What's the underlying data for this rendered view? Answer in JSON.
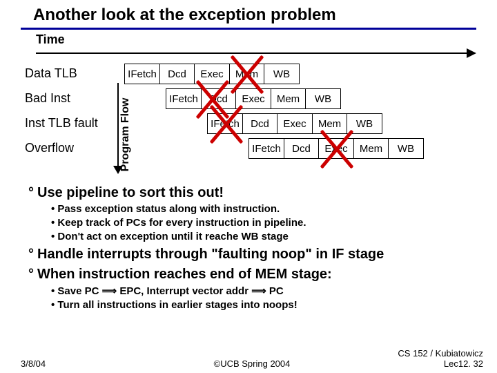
{
  "title": "Another look at the exception problem",
  "time_label": "Time",
  "program_flow_label": "Program Flow",
  "rows": {
    "r0": "Data TLB",
    "r1": "Bad Inst",
    "r2": "Inst TLB fault",
    "r3": "Overflow"
  },
  "stages": {
    "ifetch": "IFetch",
    "dcd": "Dcd",
    "exec": "Exec",
    "mem": "Mem",
    "wb": "WB"
  },
  "points": {
    "p1": "Use pipeline to sort this out!",
    "p1a": "Pass exception status along with instruction.",
    "p1b": "Keep track of PCs for every instruction in pipeline.",
    "p1c": "Don't act on exception until it reache WB stage",
    "p2": "Handle interrupts through \"faulting noop\" in IF stage",
    "p3": "When instruction reaches end of MEM stage:",
    "p3a_pre": "Save PC ",
    "p3a_mid": " EPC, Interrupt vector addr ",
    "p3a_post": " PC",
    "p3b": "Turn all instructions in earlier stages into noops!"
  },
  "footer": {
    "date": "3/8/04",
    "copyright": "©UCB Spring 2004",
    "course": "CS 152 / Kubiatowicz",
    "lec": "Lec12. 32"
  }
}
